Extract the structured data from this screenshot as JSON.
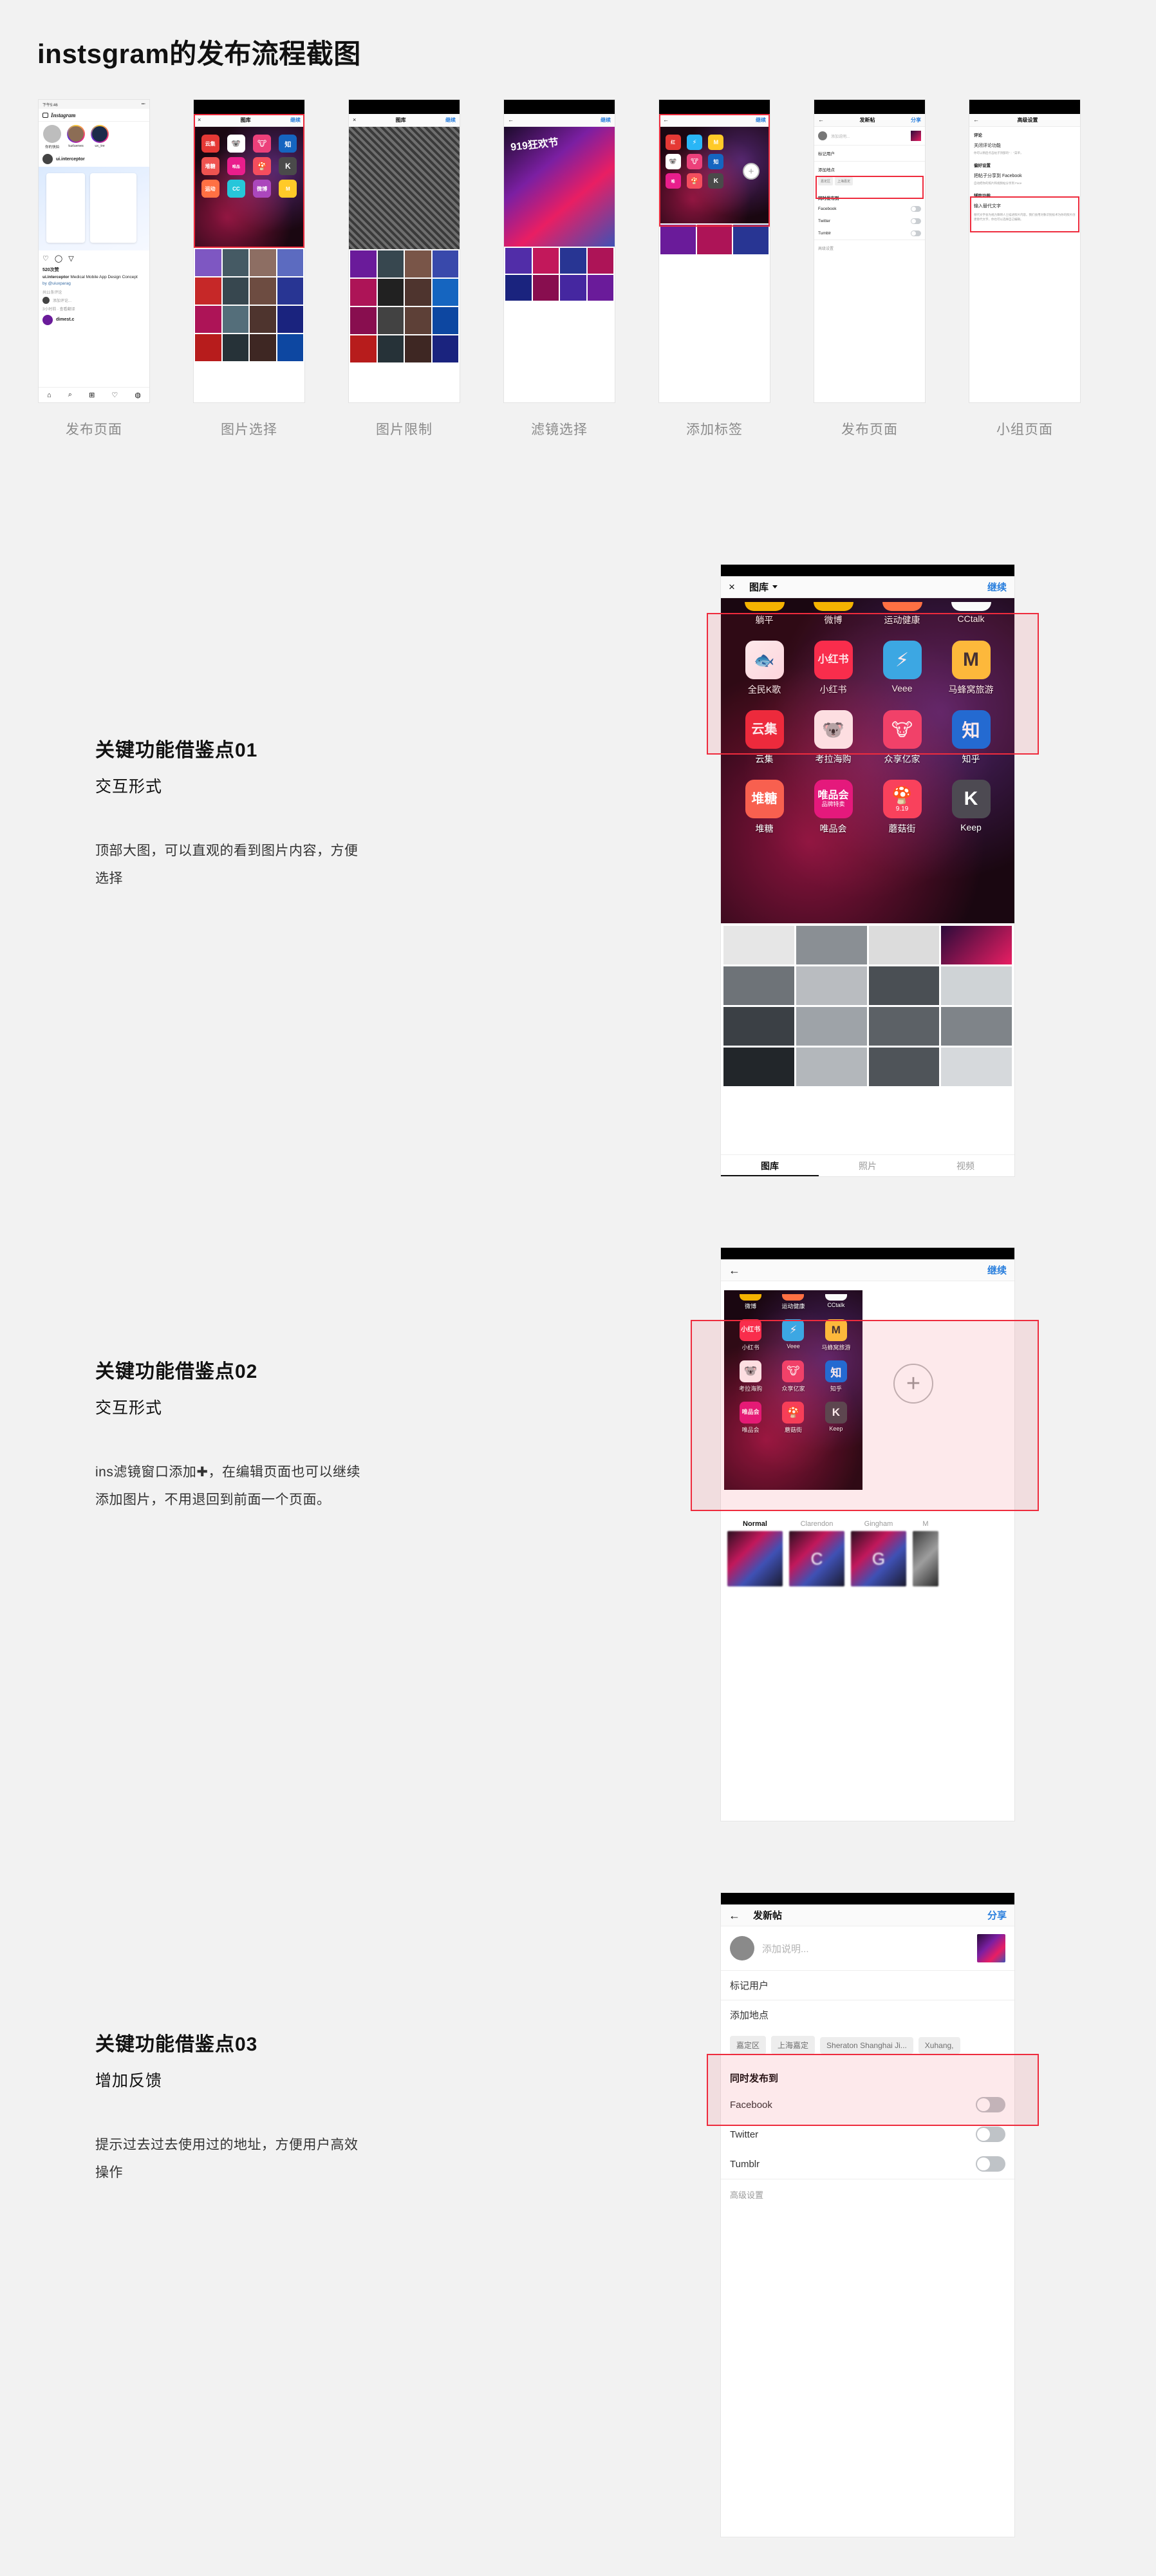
{
  "doc": {
    "title": "instsgram的发布流程截图"
  },
  "flow": {
    "steps": [
      {
        "caption": "发布页面"
      },
      {
        "caption": "图片选择"
      },
      {
        "caption": "图片限制"
      },
      {
        "caption": "滤镜选择"
      },
      {
        "caption": "添加标签"
      },
      {
        "caption": "发布页面"
      },
      {
        "caption": "小组页面"
      }
    ],
    "thumb1": {
      "status_time": "下午5:46",
      "brand": "Instagram",
      "stories": [
        "你的快拍",
        "tuzluenes",
        "ux_tre"
      ],
      "post_user": "ui.interceptor",
      "likes": "520次赞",
      "caption_user": "ui.interceptor",
      "caption_text": "Medical Mobile App Design Concept",
      "caption_by": "by @uiuxparag",
      "comments": "共11条评论",
      "add_comment": "添加评论...",
      "time_translate": "3小时前 · 查看翻译",
      "next_user": "dimest.c"
    },
    "thumb2": {
      "close": "×",
      "title": "图库",
      "action": "继续"
    },
    "thumb3": {
      "close": "×",
      "title": "图库",
      "action": "继续"
    },
    "thumb4": {
      "back": "←",
      "action": "继续"
    },
    "thumb5": {
      "back": "←",
      "action": "继续"
    },
    "thumb6": {
      "back": "←",
      "title": "发新帖",
      "action": "分享",
      "placeholder": "添加说明...",
      "tag_user": "标记用户",
      "add_location": "添加地点",
      "chips": [
        "嘉定区",
        "上海嘉定"
      ],
      "share_to": "同时发布到",
      "networks": [
        "Facebook",
        "Twitter",
        "Tumblr"
      ],
      "advanced": "高级设置"
    },
    "thumb7": {
      "back": "←",
      "title": "高级设置",
      "groups": [
        {
          "head": "评论",
          "item": "关闭评论功能",
          "desc": "你可以稍后点击帖子顶部的\" ：\"菜单，"
        },
        {
          "head": "偏好设置",
          "item": "把帖子分享到 Facebook",
          "desc": "自动把你的照片和视频帖分享到 Face"
        },
        {
          "head": "辅助功能",
          "item": "输入替代文字",
          "desc": "替代文字会为视力障碍人士描述照片内容。我们会用对象识别技术为你的照片创建替代文字，你也可以选择自己编辑。"
        }
      ]
    }
  },
  "sections": [
    {
      "heading": "关键功能借鉴点01",
      "subheading": "交互形式",
      "body": "顶部大图，可以直观的看到图片内容，方便选择"
    },
    {
      "heading": "关键功能借鉴点02",
      "subheading": "交互形式",
      "body": "ins滤镜窗口添加✚，在编辑页面也可以继续添加图片，不用退回到前面一个页面。"
    },
    {
      "heading": "关键功能借鉴点03",
      "subheading": "增加反馈",
      "body": "提示过去过去使用过的地址，方便用户高效操作"
    }
  ],
  "mockup1": {
    "close_icon": "×",
    "title": "图库",
    "action": "继续",
    "apps_row0": [
      "躺平",
      "微博",
      "运动健康",
      "CCtalk"
    ],
    "apps_row1": [
      "全民K歌",
      "小红书",
      "Veee",
      "马蜂窝旅游"
    ],
    "apps_row2": [
      "云集",
      "考拉海购",
      "众享亿家",
      "知乎"
    ],
    "apps_row3": [
      "堆糖",
      "唯品会",
      "蘑菇街",
      "Keep"
    ],
    "icon_glyphs_row1": [
      "🐟",
      "小红书",
      "⚡",
      "M"
    ],
    "icon_glyphs_row2": [
      "云集",
      "🐨",
      "🐮",
      "知"
    ],
    "icon_glyphs_row3": [
      "堆糖",
      "唯品会",
      "🍄",
      "K"
    ],
    "mushroom_date": "9.19",
    "vip_sub": "品牌特卖",
    "tabs": [
      "图库",
      "照片",
      "视频"
    ],
    "active_tab": "图库"
  },
  "mockup2": {
    "back_icon": "←",
    "action": "继续",
    "apps_row0": [
      "微博",
      "运动健康",
      "CCtalk"
    ],
    "apps_row1": [
      "小红书",
      "Veee",
      "马蜂窝旅游"
    ],
    "apps_row2": [
      "考拉海购",
      "众享亿家",
      "知乎"
    ],
    "apps_row3": [
      "唯品会",
      "蘑菇街",
      "Keep"
    ],
    "plus_label": "+",
    "filters": [
      "Normal",
      "Clarendon",
      "Gingham",
      "M"
    ],
    "filter_glyphs": [
      "",
      "C",
      "G",
      ""
    ],
    "active_filter": "Normal"
  },
  "mockup3": {
    "back_icon": "←",
    "title": "发新帖",
    "action": "分享",
    "placeholder": "添加说明...",
    "tag_user": "标记用户",
    "add_location": "添加地点",
    "chips": [
      "嘉定区",
      "上海嘉定",
      "Sheraton Shanghai Ji...",
      "Xuhang,"
    ],
    "share_to": "同时发布到",
    "networks": [
      "Facebook",
      "Twitter",
      "Tumblr"
    ],
    "advanced": "高级设置"
  },
  "colors": {
    "accent_blue": "#2a7fdd",
    "annotation_red": "#ee2b3d",
    "page_bg": "#f2f2f2",
    "muted_text": "#8b8b8b"
  }
}
